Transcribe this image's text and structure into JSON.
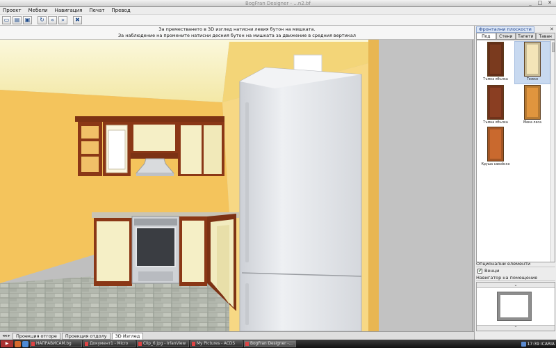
{
  "window": {
    "title": "BogFran Designer - ...n2.bf"
  },
  "menu": {
    "items": [
      "Проект",
      "Мебели",
      "Навигация",
      "Печат",
      "Превод"
    ]
  },
  "toolbar": {
    "buttons": [
      "new-icon",
      "open-icon",
      "save-icon",
      "rotate-icon",
      "back-icon",
      "forward-icon",
      "delete-icon"
    ]
  },
  "hint": {
    "line1": "За преместването в 3D изглед натисни левия бутон на мишката.",
    "line2": "За наблюдение на промените натисни десния бутон на мишката за движение в средния вертикал"
  },
  "view_tabs": {
    "items": [
      "Проекция отгоре",
      "Проекция отдолу",
      "3D Изглед"
    ],
    "active_index": 2
  },
  "right_panel": {
    "header": "Фронтални плоскости",
    "tabs": [
      "Под",
      "Стени",
      "Тапети",
      "Таван"
    ],
    "active_tab": 0,
    "swatches": [
      {
        "label": "Тъмна ябълка",
        "color": "#7a3a1e",
        "selected": false
      },
      {
        "label": "Тежко",
        "color": "#f3e4b8",
        "selected": true
      },
      {
        "label": "Тъмна ябълка",
        "color": "#8a3e22",
        "selected": false
      },
      {
        "label": "Мека леса",
        "color": "#e0953e",
        "selected": false
      },
      {
        "label": "Круша савойско",
        "color": "#c9692e",
        "selected": false
      }
    ],
    "options_header": "Опционални елементи",
    "option_label": "Венци",
    "option_checked": true,
    "navigator_header": "Навигатор на помещение"
  },
  "taskbar": {
    "tasks": [
      "НАПРАВИСАМ.bg",
      "Документ1 - Micro",
      "Clip_6.jpg - IrfanView",
      "My Pictures - ACDS",
      "BogFran Designer -..."
    ],
    "active_index": 4,
    "clock": "17:39",
    "tray_label": "ICARIA"
  },
  "colors": {
    "wall_left": "#f5c860",
    "wall_back": "#f8de88",
    "wall_right_edge": "#e9bb52",
    "ceiling": "#f6f0c8",
    "floor_tile": "#b7bcb2",
    "wood": "#8a3716",
    "cabinet_cream": "#f5efc6",
    "fridge": "#e4e6ea"
  }
}
